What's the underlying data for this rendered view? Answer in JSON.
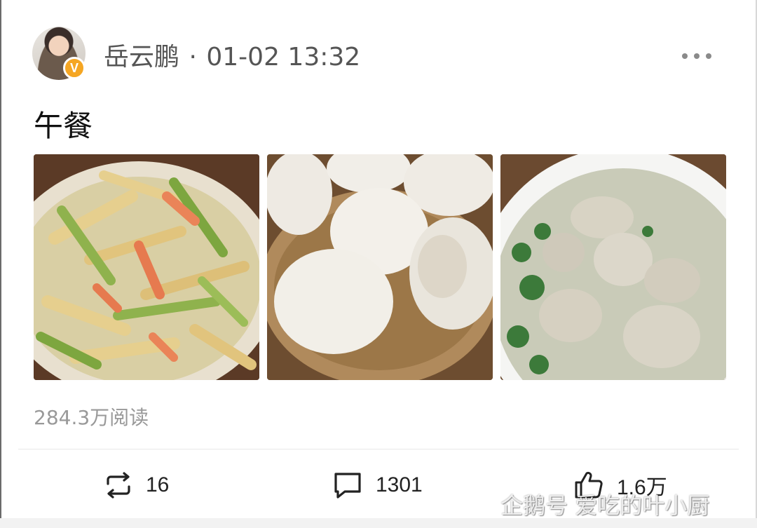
{
  "post": {
    "author": "岳云鹏",
    "separator": "·",
    "timestamp": "01-02 13:32",
    "verified_badge": "V",
    "more_icon": "more-horizontal-icon",
    "text": "午餐",
    "images": [
      {
        "icon": "photo-celery-yuba-dish"
      },
      {
        "icon": "photo-steamed-buns"
      },
      {
        "icon": "photo-meatball-soup"
      }
    ],
    "reads": "284.3万阅读"
  },
  "actions": {
    "repost_count": "16",
    "comment_count": "1301",
    "like_count": "1.6万"
  },
  "watermark": "企鹅号 爱吃的叶小厨",
  "colors": {
    "badge": "#f5a623",
    "muted_text": "#999999",
    "divider": "#e8e8e8"
  }
}
